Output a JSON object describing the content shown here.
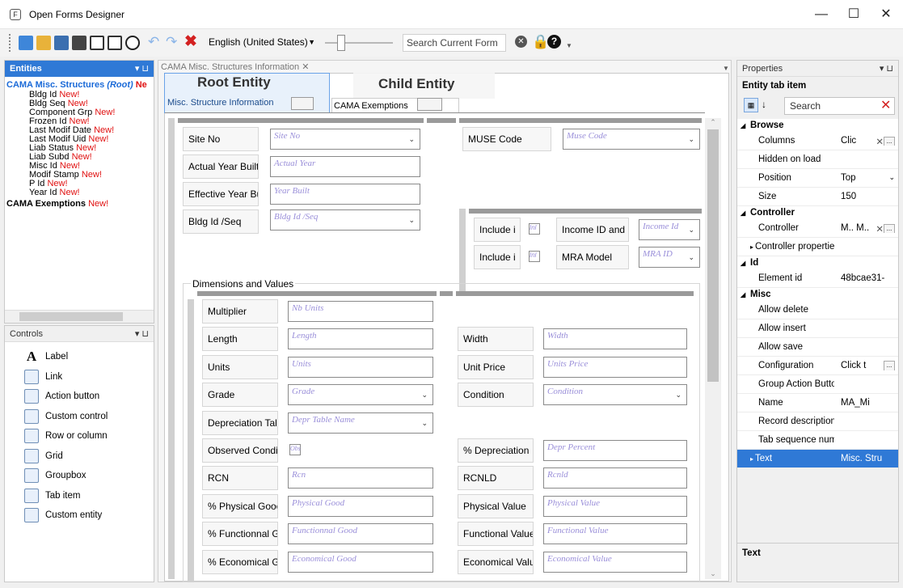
{
  "window": {
    "title": "Open Forms Designer",
    "app_icon_letter": "F"
  },
  "toolbar": {
    "language": "English (United States)",
    "search_placeholder": "Search Current Form"
  },
  "entities_pane": {
    "title": "Entities",
    "root": {
      "name": "CAMA Misc. Structures",
      "tag": "(Root)",
      "new": "Ne"
    },
    "items": [
      {
        "label": "Bldg Id",
        "new": "New!"
      },
      {
        "label": "Bldg Seq",
        "new": "New!"
      },
      {
        "label": "Component Grp",
        "new": "New!"
      },
      {
        "label": "Frozen Id",
        "new": "New!"
      },
      {
        "label": "Last Modif Date",
        "new": "New!"
      },
      {
        "label": "Last Modif Uid",
        "new": "New!"
      },
      {
        "label": "Liab Status",
        "new": "New!"
      },
      {
        "label": "Liab Subd",
        "new": "New!"
      },
      {
        "label": "Misc Id",
        "new": "New!"
      },
      {
        "label": "Modif Stamp",
        "new": "New!"
      },
      {
        "label": "P Id",
        "new": "New!"
      },
      {
        "label": "Year Id",
        "new": "New!"
      }
    ],
    "second_entity": {
      "name": "CAMA Exemptions",
      "new": "New!"
    }
  },
  "controls_pane": {
    "title": "Controls",
    "items": [
      "Label",
      "Link",
      "Action button",
      "Custom control",
      "Row or column",
      "Grid",
      "Groupbox",
      "Tab item",
      "Custom entity"
    ]
  },
  "document": {
    "tab_title": "CAMA Misc. Structures Information",
    "root_entity_label": "Root Entity",
    "child_entity_label": "Child Entity",
    "form_tabs": [
      "Misc. Structure Information",
      "CAMA Exemptions"
    ],
    "top_fields": [
      {
        "label": "Site No",
        "placeholder": "Site No"
      },
      {
        "label": "Actual Year Built",
        "placeholder": "Actual Year"
      },
      {
        "label": "Effective Year Bu",
        "placeholder": "Year Built"
      },
      {
        "label": "Bldg Id /Seq",
        "placeholder": "Bldg Id /Seq"
      },
      {
        "label": "MUSE Code",
        "placeholder": "Muse Code"
      },
      {
        "label": "Include i",
        "check": "Inl",
        "label2": "Income ID and",
        "placeholder": "Income Id"
      },
      {
        "label": "Include i",
        "check": "Inl",
        "label2": "MRA Model",
        "placeholder": "MRA ID"
      }
    ],
    "groupbox_title": "Dimensions and Values",
    "dim_fields": [
      {
        "label": "Multiplier",
        "placeholder": "Nb Units",
        "label2": "",
        "placeholder2": ""
      },
      {
        "label": "Length",
        "placeholder": "Length",
        "label2": "Width",
        "placeholder2": "Width"
      },
      {
        "label": "Units",
        "placeholder": "Units",
        "label2": "Unit Price",
        "placeholder2": "Units Price"
      },
      {
        "label": "Grade",
        "placeholder": "Grade",
        "label2": "Condition",
        "placeholder2": "Condition"
      },
      {
        "label": "Depreciation Tal",
        "placeholder": "Depr Table Name",
        "label2": "",
        "placeholder2": ""
      },
      {
        "label": "Observed Condi",
        "placeholder": "Obs",
        "label2": "% Depreciation",
        "placeholder2": "Depr Percent"
      },
      {
        "label": "RCN",
        "placeholder": "Rcn",
        "label2": "RCNLD",
        "placeholder2": "Rcnld"
      },
      {
        "label": "% Physical Gooc",
        "placeholder": "Physical Good",
        "label2": "Physical Value",
        "placeholder2": "Physical Value"
      },
      {
        "label": "% Functionnal G",
        "placeholder": "Functionnal Good",
        "label2": "Functional Value",
        "placeholder2": "Functional Value"
      },
      {
        "label": "% Economical G",
        "placeholder": "Economical Good",
        "label2": "Economical Valu",
        "placeholder2": "Economical Value"
      }
    ]
  },
  "properties_pane": {
    "title": "Properties",
    "subtitle": "Entity tab item",
    "search_placeholder": "Search",
    "sections": [
      {
        "category": "Browse",
        "rows": [
          {
            "name": "Columns",
            "value": "Clic"
          },
          {
            "name": "Hidden on load",
            "value": ""
          },
          {
            "name": "Position",
            "value": "Top"
          },
          {
            "name": "Size",
            "value": "150"
          }
        ]
      },
      {
        "category": "Controller",
        "rows": [
          {
            "name": "Controller",
            "value": "M..  M.."
          },
          {
            "name": "Controller properties",
            "value": ""
          }
        ]
      },
      {
        "category": "Id",
        "rows": [
          {
            "name": "Element id",
            "value": "48bcae31-"
          }
        ]
      },
      {
        "category": "Misc",
        "rows": [
          {
            "name": "Allow delete",
            "value": ""
          },
          {
            "name": "Allow insert",
            "value": ""
          },
          {
            "name": "Allow save",
            "value": ""
          },
          {
            "name": "Configuration",
            "value": "Click t"
          },
          {
            "name": "Group Action Buttons",
            "value": ""
          },
          {
            "name": "Name",
            "value": "MA_Mi"
          },
          {
            "name": "Record description",
            "value": ""
          },
          {
            "name": "Tab sequence number",
            "value": ""
          },
          {
            "name": "Text",
            "value": "Misc. Stru"
          }
        ]
      }
    ],
    "footer_label": "Text"
  }
}
